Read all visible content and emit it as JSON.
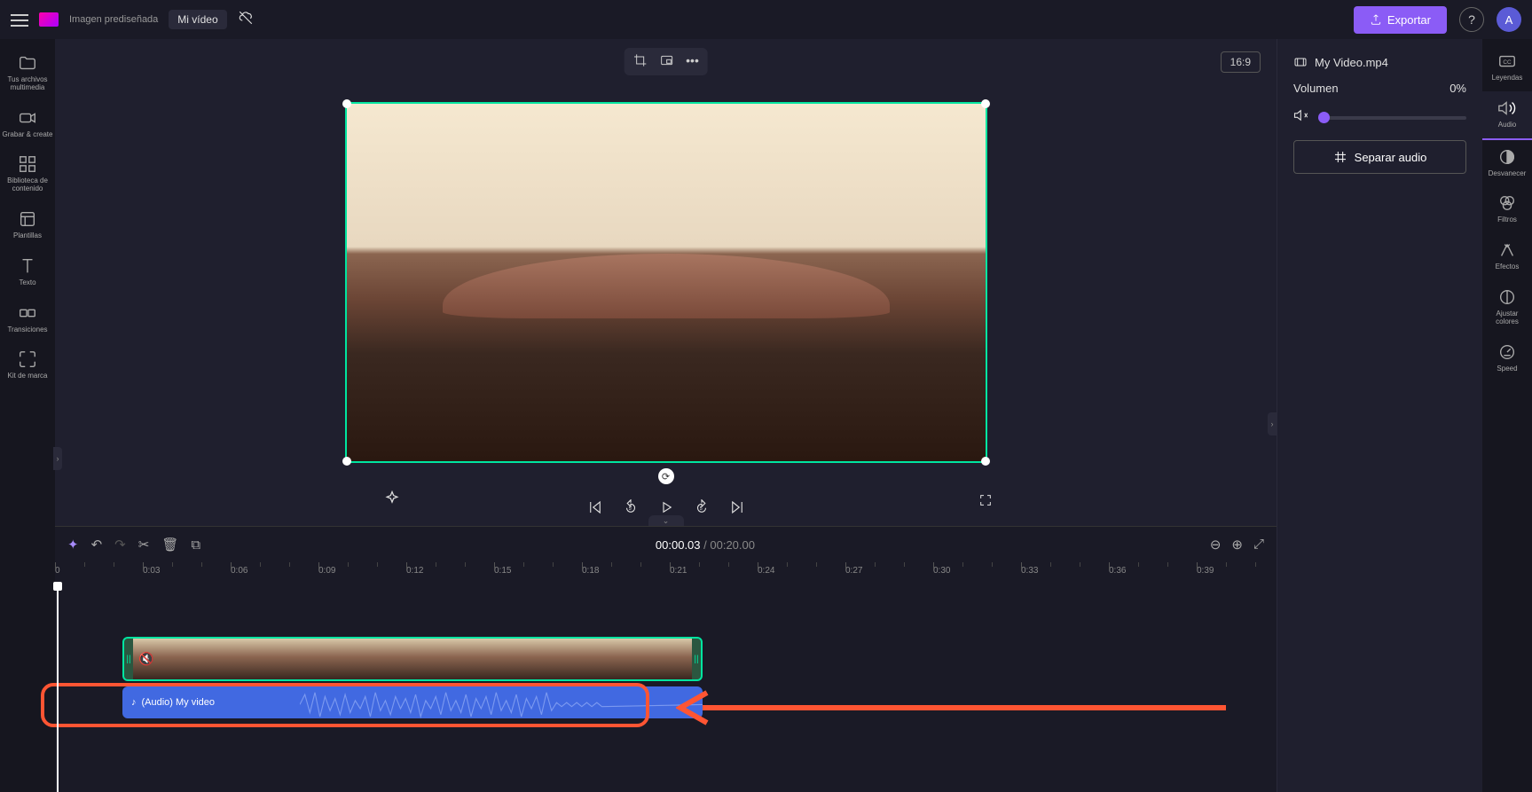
{
  "header": {
    "subtitle": "Imagen prediseñada",
    "title": "Mi vídeo",
    "export_label": "Exportar",
    "avatar_letter": "A",
    "aspect_ratio": "16:9"
  },
  "left_sidebar": {
    "items": [
      {
        "label": "Tus archivos multimedia"
      },
      {
        "label": "Grabar &\ncreate"
      },
      {
        "label": "Biblioteca de contenido"
      },
      {
        "label": "Plantillas"
      },
      {
        "label": "Texto"
      },
      {
        "label": "Transiciones"
      },
      {
        "label": "Kit de marca"
      }
    ]
  },
  "right_sidebar": {
    "items": [
      {
        "label": "Leyendas"
      },
      {
        "label": "Audio"
      },
      {
        "label": "Desvanecer"
      },
      {
        "label": "Filtros"
      },
      {
        "label": "Efectos"
      },
      {
        "label": "Ajustar colores"
      },
      {
        "label": "Speed"
      }
    ]
  },
  "properties": {
    "clip_name": "My Video.mp4",
    "volume_label": "Volumen",
    "volume_value": "0%",
    "separate_audio_label": "Separar audio"
  },
  "timeline": {
    "current_time": "00:00.03",
    "total_time": "00:20.00",
    "audio_clip_label": "(Audio) My video",
    "marks": [
      "0",
      "0:03",
      "0:06",
      "0:09",
      "0:12",
      "0:15",
      "0:18",
      "0:21",
      "0:24",
      "0:27",
      "0:30",
      "0:33",
      "0:36",
      "0:39"
    ]
  }
}
